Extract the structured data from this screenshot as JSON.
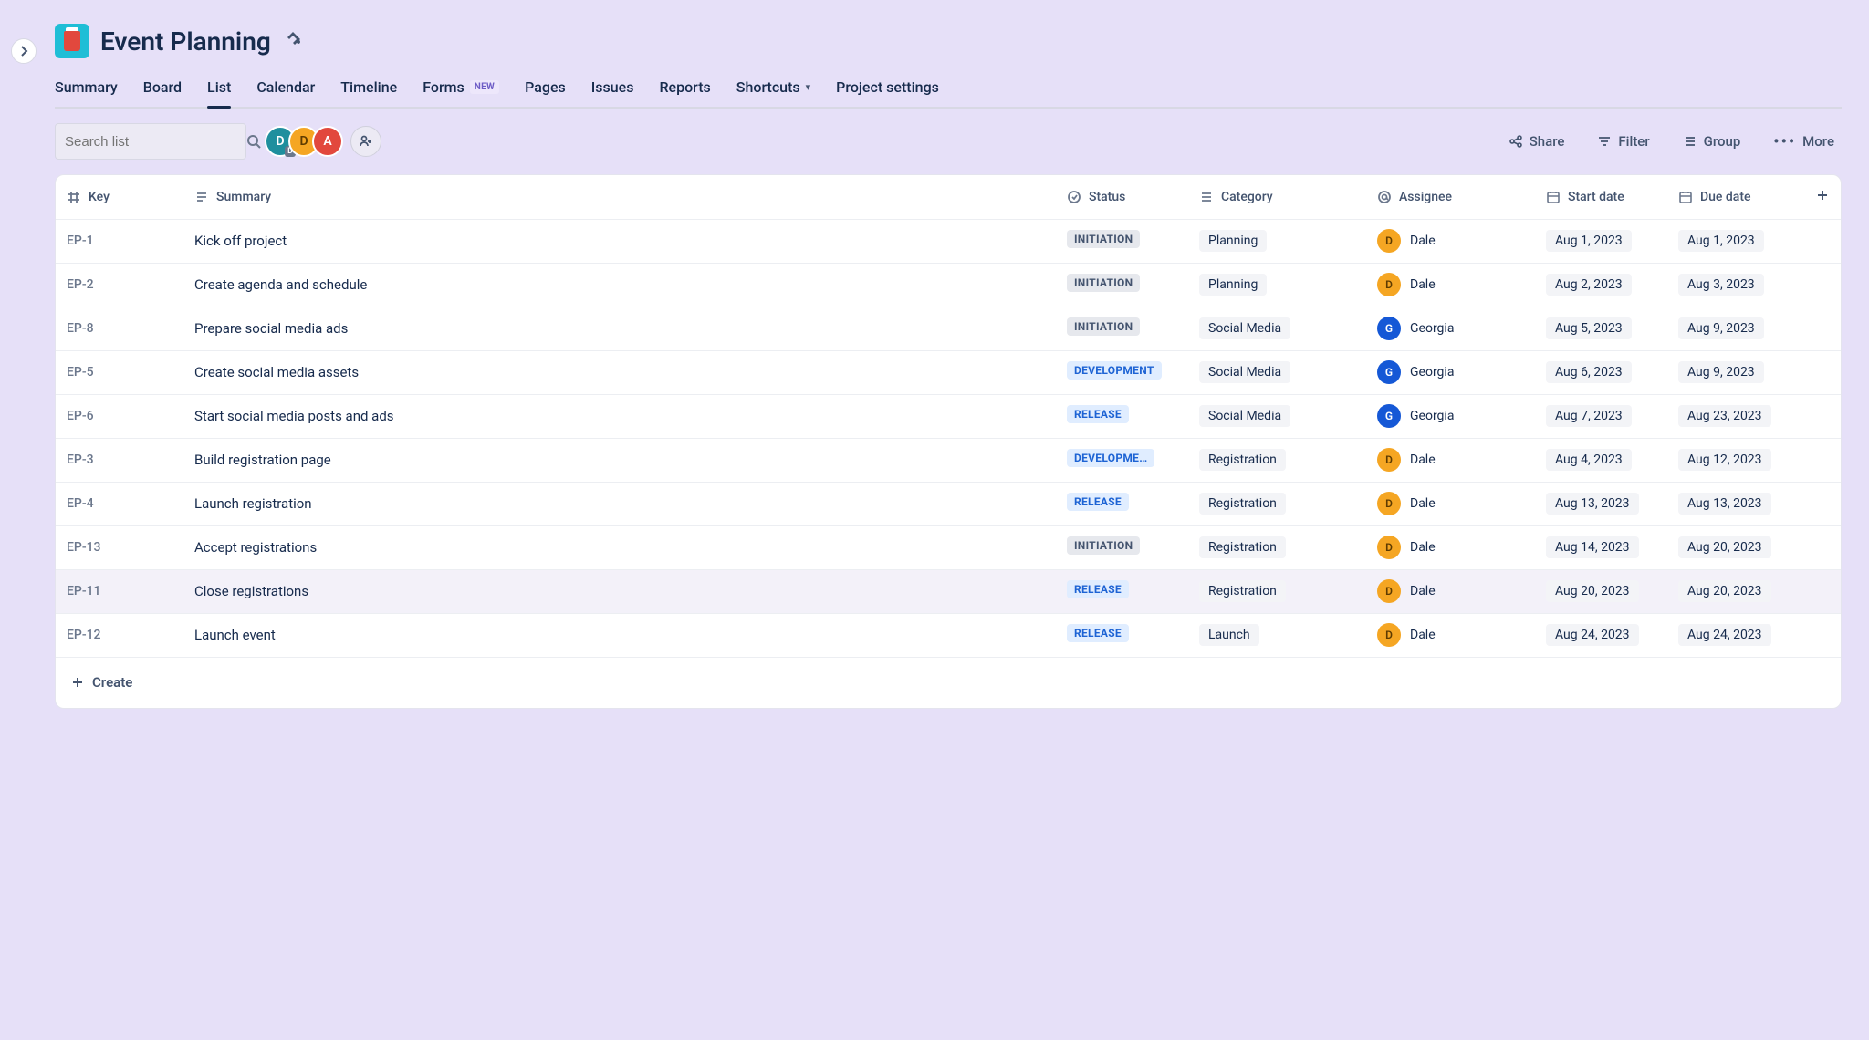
{
  "project": {
    "title": "Event Planning"
  },
  "tabs": [
    {
      "label": "Summary"
    },
    {
      "label": "Board"
    },
    {
      "label": "List",
      "active": true
    },
    {
      "label": "Calendar"
    },
    {
      "label": "Timeline"
    },
    {
      "label": "Forms",
      "badge": "NEW"
    },
    {
      "label": "Pages"
    },
    {
      "label": "Issues"
    },
    {
      "label": "Reports"
    },
    {
      "label": "Shortcuts",
      "dropdown": true
    },
    {
      "label": "Project settings"
    }
  ],
  "search": {
    "placeholder": "Search list"
  },
  "toolbar_avatars": [
    {
      "letter": "D",
      "color": "teal",
      "mini": "D"
    },
    {
      "letter": "D",
      "color": "orange"
    },
    {
      "letter": "A",
      "color": "red"
    }
  ],
  "toolbar": {
    "share": "Share",
    "filter": "Filter",
    "group": "Group",
    "more": "More"
  },
  "columns": {
    "key": "Key",
    "summary": "Summary",
    "status": "Status",
    "category": "Category",
    "assignee": "Assignee",
    "start": "Start date",
    "due": "Due date"
  },
  "rows": [
    {
      "key": "EP-1",
      "summary": "Kick off project",
      "status": "INITIATION",
      "status_class": "initiation",
      "category": "Planning",
      "assignee": "Dale",
      "assignee_letter": "D",
      "assignee_color": "dale",
      "start": "Aug 1, 2023",
      "due": "Aug 1, 2023"
    },
    {
      "key": "EP-2",
      "summary": "Create agenda and schedule",
      "status": "INITIATION",
      "status_class": "initiation",
      "category": "Planning",
      "assignee": "Dale",
      "assignee_letter": "D",
      "assignee_color": "dale",
      "start": "Aug 2, 2023",
      "due": "Aug 3, 2023"
    },
    {
      "key": "EP-8",
      "summary": "Prepare social media ads",
      "status": "INITIATION",
      "status_class": "initiation",
      "category": "Social Media",
      "assignee": "Georgia",
      "assignee_letter": "G",
      "assignee_color": "georgia",
      "start": "Aug 5, 2023",
      "due": "Aug 9, 2023"
    },
    {
      "key": "EP-5",
      "summary": "Create social media assets",
      "status": "DEVELOPMENT",
      "status_class": "development",
      "category": "Social Media",
      "assignee": "Georgia",
      "assignee_letter": "G",
      "assignee_color": "georgia",
      "start": "Aug 6, 2023",
      "due": "Aug 9, 2023"
    },
    {
      "key": "EP-6",
      "summary": "Start social media posts and ads",
      "status": "RELEASE",
      "status_class": "release",
      "category": "Social Media",
      "assignee": "Georgia",
      "assignee_letter": "G",
      "assignee_color": "georgia",
      "start": "Aug 7, 2023",
      "due": "Aug 23, 2023"
    },
    {
      "key": "EP-3",
      "summary": "Build registration page",
      "status": "DEVELOPME…",
      "status_class": "development",
      "category": "Registration",
      "assignee": "Dale",
      "assignee_letter": "D",
      "assignee_color": "dale",
      "start": "Aug 4, 2023",
      "due": "Aug 12, 2023"
    },
    {
      "key": "EP-4",
      "summary": "Launch registration",
      "status": "RELEASE",
      "status_class": "release",
      "category": "Registration",
      "assignee": "Dale",
      "assignee_letter": "D",
      "assignee_color": "dale",
      "start": "Aug 13, 2023",
      "due": "Aug 13, 2023"
    },
    {
      "key": "EP-13",
      "summary": "Accept registrations",
      "status": "INITIATION",
      "status_class": "initiation",
      "category": "Registration",
      "assignee": "Dale",
      "assignee_letter": "D",
      "assignee_color": "dale",
      "start": "Aug 14, 2023",
      "due": "Aug 20, 2023"
    },
    {
      "key": "EP-11",
      "summary": "Close registrations",
      "status": "RELEASE",
      "status_class": "release",
      "category": "Registration",
      "assignee": "Dale",
      "assignee_letter": "D",
      "assignee_color": "dale",
      "start": "Aug 20, 2023",
      "due": "Aug 20, 2023",
      "hovered": true
    },
    {
      "key": "EP-12",
      "summary": "Launch event",
      "status": "RELEASE",
      "status_class": "release",
      "category": "Launch",
      "assignee": "Dale",
      "assignee_letter": "D",
      "assignee_color": "dale",
      "start": "Aug 24, 2023",
      "due": "Aug 24, 2023"
    }
  ],
  "create_label": "Create"
}
